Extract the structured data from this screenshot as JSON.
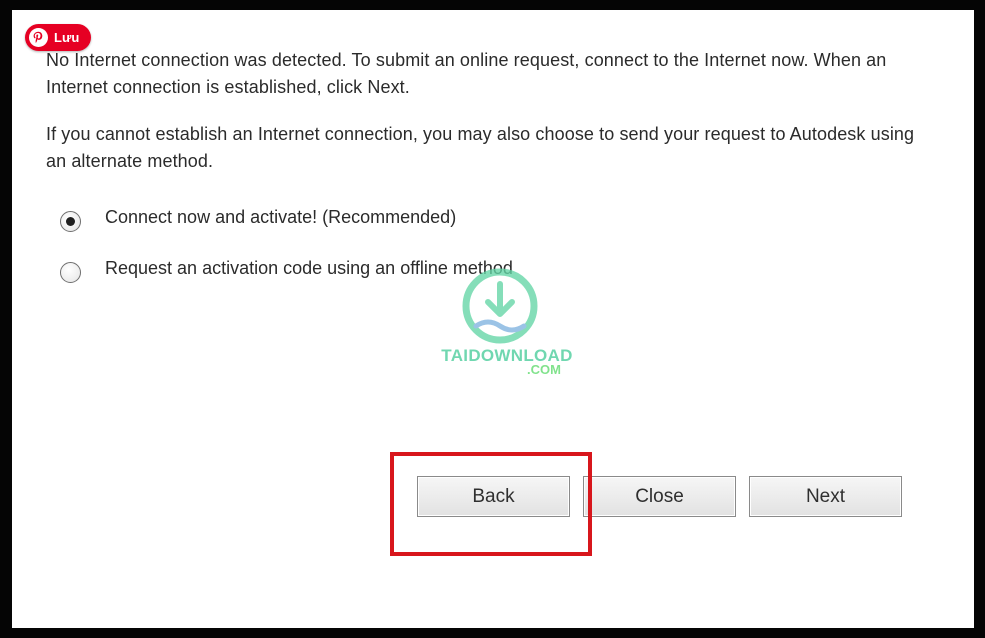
{
  "pin_badge": {
    "label": "Lưu",
    "icon": "pinterest-icon",
    "color": "#e60023"
  },
  "dialog": {
    "paragraph1": "No Internet connection was detected. To submit an online request, connect to the Internet now. When an Internet connection is established, click Next.",
    "paragraph2": "If you cannot establish an Internet connection, you may also choose to send your request to Autodesk using an alternate method.",
    "options": [
      {
        "label": "Connect now and activate! (Recommended)",
        "selected": true
      },
      {
        "label": "Request an activation code using an offline method",
        "selected": false
      }
    ],
    "buttons": {
      "back": "Back",
      "close": "Close",
      "next": "Next"
    },
    "highlight_color": "#d8161c"
  },
  "watermark": {
    "text": "TAIDOWNLOAD",
    "sub": ".COM",
    "icon": "download-icon",
    "color": "#49cc9a"
  }
}
